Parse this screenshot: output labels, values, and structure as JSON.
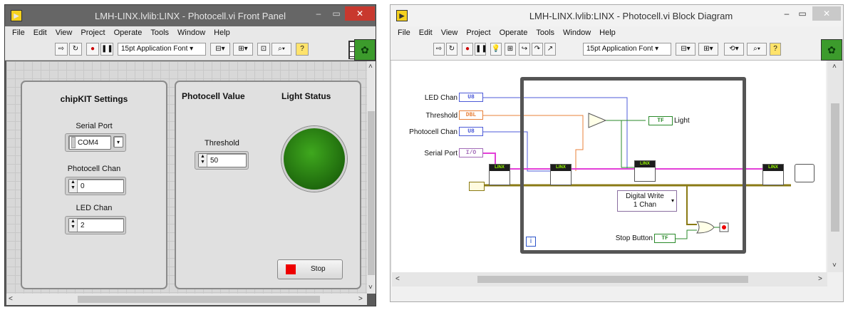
{
  "front_panel": {
    "title": "LMH-LINX.lvlib:LINX - Photocell.vi Front Panel",
    "menu": [
      "File",
      "Edit",
      "View",
      "Project",
      "Operate",
      "Tools",
      "Window",
      "Help"
    ],
    "font": "15pt Application Font",
    "settings": {
      "heading": "chipKIT Settings",
      "serial_label": "Serial Port",
      "serial_value": "COM4",
      "photocell_label": "Photocell Chan",
      "photocell_value": "0",
      "led_label": "LED Chan",
      "led_value": "2"
    },
    "photocell_value_heading": "Photocell Value",
    "light_status_heading": "Light Status",
    "threshold_label": "Threshold",
    "threshold_value": "50",
    "stop_label": "Stop",
    "led_color": "#2e8a17"
  },
  "block_diagram": {
    "title": "LMH-LINX.lvlib:LINX - Photocell.vi Block Diagram",
    "menu": [
      "File",
      "Edit",
      "View",
      "Project",
      "Operate",
      "Tools",
      "Window",
      "Help"
    ],
    "font": "15pt Application Font",
    "labels": {
      "led_chan": "LED Chan",
      "threshold": "Threshold",
      "photocell_chan": "Photocell Chan",
      "serial_port": "Serial Port",
      "light": "Light",
      "stop_button": "Stop Button",
      "digital_write": "Digital Write",
      "one_chan": "1 Chan",
      "loop_index": "i"
    },
    "terminals": {
      "u8": "U8",
      "dbl": "DBL",
      "tf": "TF",
      "io": "I/O"
    },
    "node_header": "LINX"
  }
}
